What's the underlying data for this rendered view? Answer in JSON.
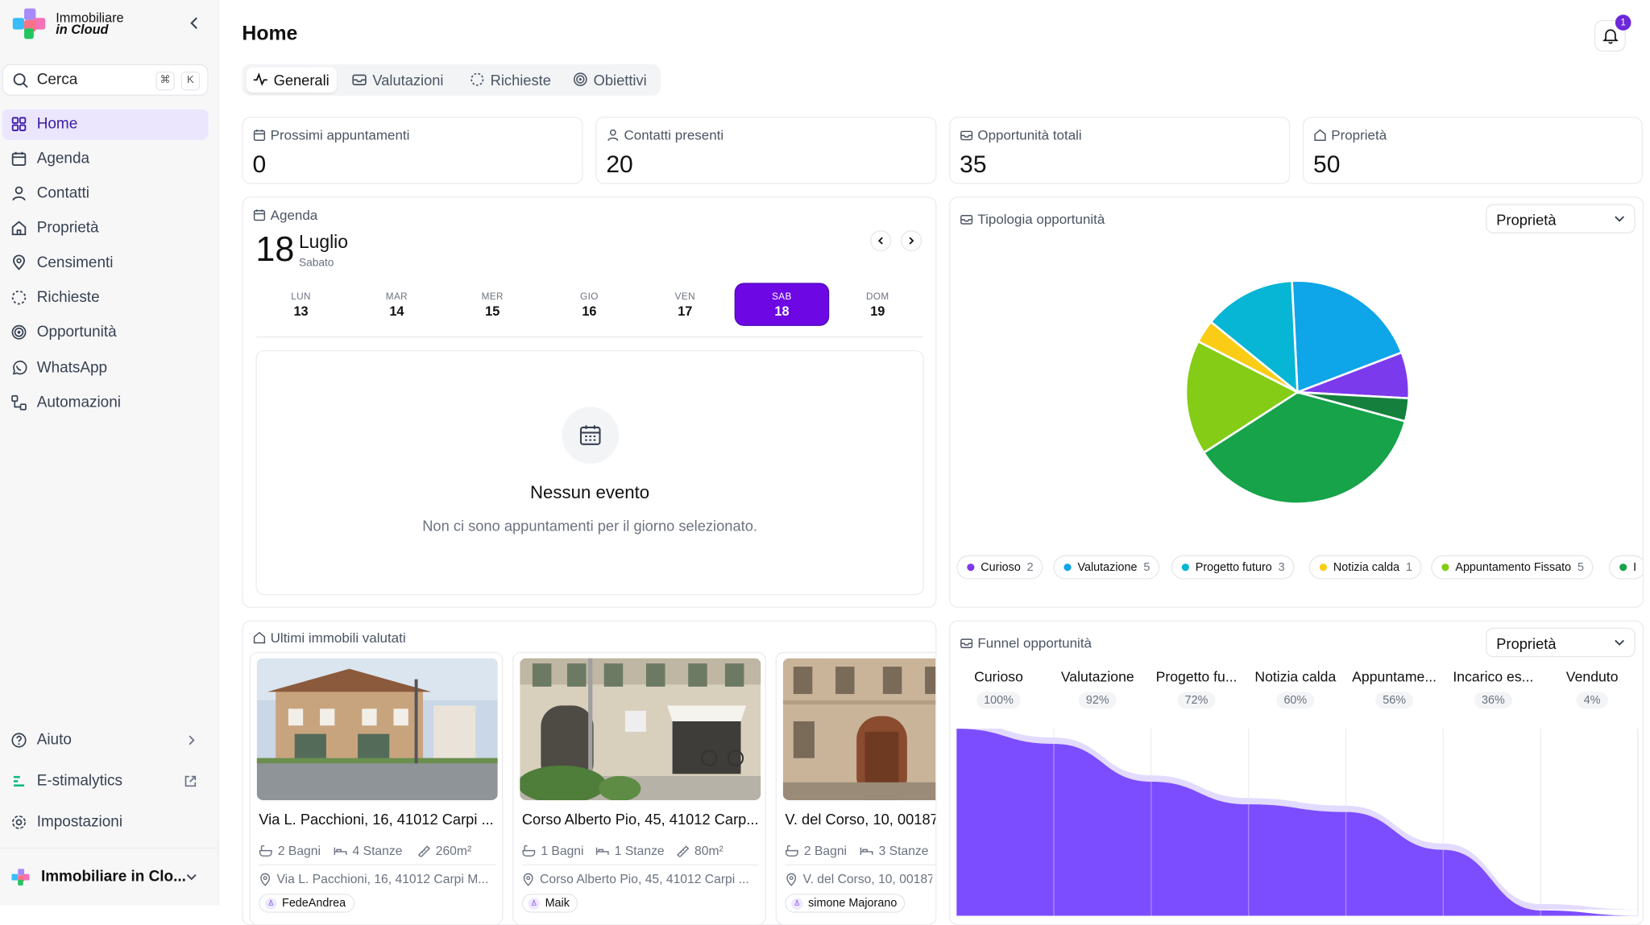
{
  "brand": {
    "line1": "Immobiliare",
    "line2": "in Cloud"
  },
  "search": {
    "placeholder": "Cerca",
    "kbd1": "⌘",
    "kbd2": "K"
  },
  "nav": [
    {
      "label": "Home",
      "icon": "grid-icon",
      "active": true
    },
    {
      "label": "Agenda",
      "icon": "calendar-icon"
    },
    {
      "label": "Contatti",
      "icon": "user-icon"
    },
    {
      "label": "Proprietà",
      "icon": "home-icon"
    },
    {
      "label": "Censimenti",
      "icon": "map-pin-user-icon"
    },
    {
      "label": "Richieste",
      "icon": "dashed-circle-icon"
    },
    {
      "label": "Opportunità",
      "icon": "target-icon"
    },
    {
      "label": "WhatsApp",
      "icon": "whatsapp-icon"
    },
    {
      "label": "Automazioni",
      "icon": "workflow-icon"
    }
  ],
  "bottom_nav": {
    "help": "Aiuto",
    "analytics": "E-stimalytics",
    "settings": "Impostazioni",
    "account": "Immobiliare in Clo..."
  },
  "header": {
    "title": "Home",
    "notifications": "1"
  },
  "tabs": [
    {
      "label": "Generali",
      "active": true
    },
    {
      "label": "Valutazioni"
    },
    {
      "label": "Richieste"
    },
    {
      "label": "Obiettivi"
    }
  ],
  "stats": [
    {
      "label": "Prossimi appuntamenti",
      "value": "0"
    },
    {
      "label": "Contatti presenti",
      "value": "20"
    },
    {
      "label": "Opportunità totali",
      "value": "35"
    },
    {
      "label": "Proprietà",
      "value": "50"
    }
  ],
  "agenda": {
    "label": "Agenda",
    "day": "18",
    "month": "Luglio",
    "weekday": "Sabato",
    "days": [
      {
        "name": "LUN",
        "num": "13"
      },
      {
        "name": "MAR",
        "num": "14"
      },
      {
        "name": "MER",
        "num": "15"
      },
      {
        "name": "GIO",
        "num": "16"
      },
      {
        "name": "VEN",
        "num": "17"
      },
      {
        "name": "SAB",
        "num": "18",
        "selected": true
      },
      {
        "name": "DOM",
        "num": "19"
      }
    ],
    "empty_title": "Nessun evento",
    "empty_subtitle": "Non ci sono appuntamenti per il giorno selezionato."
  },
  "tipologia": {
    "label": "Tipologia opportunità",
    "filter": "Proprietà",
    "legend": [
      {
        "name": "Curioso",
        "count": "2",
        "color": "#7c3aed"
      },
      {
        "name": "Valutazione",
        "count": "5",
        "color": "#0ea5e9"
      },
      {
        "name": "Progetto futuro",
        "count": "3",
        "color": "#06b6d4"
      },
      {
        "name": "Notizia calda",
        "count": "1",
        "color": "#facc15"
      },
      {
        "name": "Appuntamento Fissato",
        "count": "5",
        "color": "#84cc16"
      },
      {
        "name": "I",
        "count": "",
        "color": "#16a34a"
      }
    ]
  },
  "chart_data": [
    {
      "type": "pie",
      "title": "",
      "slices": [
        {
          "value": 6,
          "color": "#0ea5e9"
        },
        {
          "value": 2,
          "color": "#7c3aed"
        },
        {
          "value": 1,
          "color": "#15803d"
        },
        {
          "value": 11,
          "color": "#16a34a"
        },
        {
          "value": 5,
          "color": "#84cc16"
        },
        {
          "value": 1,
          "color": "#facc15"
        },
        {
          "value": 4,
          "color": "#06b6d4"
        }
      ]
    },
    {
      "type": "area",
      "title": "",
      "categories": [
        "Curioso",
        "Valutazione",
        "Progetto fu...",
        "Notizia calda",
        "Appuntame...",
        "Incarico es...",
        "Venduto"
      ],
      "values": [
        100,
        92,
        72,
        60,
        56,
        36,
        4
      ],
      "color": "#7c4dff"
    }
  ],
  "funnel": {
    "label": "Funnel opportunità",
    "filter": "Proprietà",
    "percents": [
      "100%",
      "92%",
      "72%",
      "60%",
      "56%",
      "36%",
      "4%"
    ]
  },
  "immobili": {
    "label": "Ultimi immobili valutati",
    "items": [
      {
        "title": "Via L. Pacchioni, 16, 41012 Carpi ...",
        "bagni": "2 Bagni",
        "stanze": "4 Stanze",
        "mq": "260m²",
        "address": "Via L. Pacchioni, 16, 41012 Carpi M...",
        "agent": "FedeAndrea"
      },
      {
        "title": "Corso Alberto Pio, 45, 41012 Carp...",
        "bagni": "1 Bagni",
        "stanze": "1 Stanze",
        "mq": "80m²",
        "address": "Corso Alberto Pio, 45, 41012 Carpi ...",
        "agent": "Maik"
      },
      {
        "title": "V. del Corso, 10, 00187",
        "bagni": "2 Bagni",
        "stanze": "3 Stanze",
        "mq": "",
        "address": "V. del Corso, 10, 00187",
        "agent": "simone Majorano"
      }
    ]
  }
}
